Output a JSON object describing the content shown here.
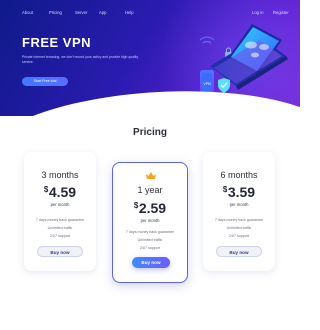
{
  "nav": {
    "items": [
      "About",
      "Pricing",
      "Server",
      "App",
      "Help"
    ],
    "login": "Log in",
    "register": "Register"
  },
  "hero": {
    "title": "FREE VPN",
    "description": "Private internet browsing, we don't record your activy and provide high quality service.",
    "cta": "Start Free trial"
  },
  "pricing": {
    "title": "Pricing",
    "plans": [
      {
        "term": "3 months",
        "currency": "$",
        "price": "4.59",
        "period": "per month",
        "features": [
          "7 days money back guarantee",
          "Unlimited traffic",
          "24/7 support"
        ],
        "button": "Buy now",
        "featured": false
      },
      {
        "term": "1 year",
        "currency": "$",
        "price": "2.59",
        "period": "per month",
        "features": [
          "7 days money back guarantee",
          "Unlimited traffic",
          "24/7 support"
        ],
        "button": "Buy now",
        "featured": true
      },
      {
        "term": "6 months",
        "currency": "$",
        "price": "3.59",
        "period": "per month",
        "features": [
          "7 days money back guarantee",
          "Unlimited traffic",
          "24/7 support"
        ],
        "button": "Buy now",
        "featured": false
      }
    ]
  },
  "icons": {
    "featured_badge": "crown-icon",
    "illustration": [
      "laptop-icon",
      "world-map-icon",
      "smartphone-icon",
      "shield-icon",
      "padlock-icon",
      "wifi-icon"
    ]
  },
  "colors": {
    "hero_start": "#0f1a8a",
    "hero_end": "#7a2bd8",
    "accent": "#3e8bff",
    "crown": "#f5a623",
    "featured_border": "#5a63e6"
  }
}
